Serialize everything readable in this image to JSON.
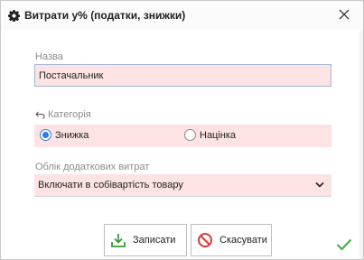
{
  "window": {
    "title": "Витрати у% (податки, знижки)",
    "title_icon": "gear-icon",
    "close_icon": "close-icon"
  },
  "form": {
    "name_label": "Назва",
    "name_value": "Постачальник",
    "category_label": "Категорія",
    "category_icon": "undo-arrow-icon",
    "category_options": [
      {
        "label": "Знижка",
        "selected": true
      },
      {
        "label": "Націнка",
        "selected": false
      }
    ],
    "costs_label": "Облік додаткових витрат",
    "costs_value": "Включати в собівартість товару",
    "field_highlight_color": "#fde3e3"
  },
  "buttons": {
    "save_label": "Записати",
    "save_icon": "download-icon",
    "cancel_label": "Скасувати",
    "cancel_icon": "prohibited-icon"
  },
  "status": {
    "ok_icon": "checkmark-icon",
    "ok_color": "#4caf50"
  }
}
